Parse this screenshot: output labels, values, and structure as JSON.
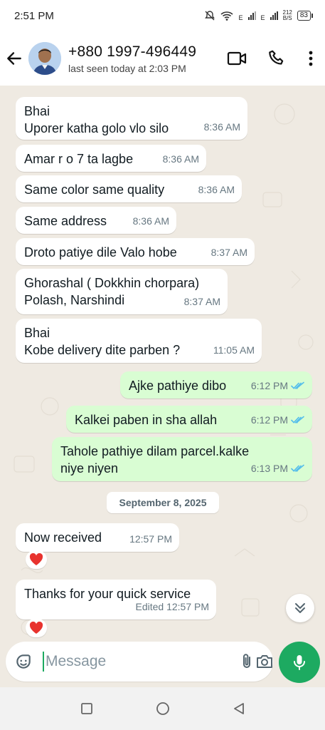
{
  "status_bar": {
    "time": "2:51 PM",
    "net_rate_top": "212",
    "net_rate_bottom": "B/S",
    "battery": "83",
    "sig_label_1": "E",
    "sig_label_2": "E"
  },
  "header": {
    "contact_name": "+880 1997-496449",
    "contact_status": "last seen today at 2:03 PM",
    "icons": [
      "back-arrow-icon",
      "video-call-icon",
      "phone-icon",
      "more-options-icon"
    ]
  },
  "messages": [
    {
      "dir": "in",
      "lines": [
        "Bhai",
        "Uporer katha golo vlo silo"
      ],
      "time": "8:36 AM"
    },
    {
      "dir": "in",
      "lines": [
        "Amar r o 7 ta lagbe"
      ],
      "time": "8:36 AM"
    },
    {
      "dir": "in",
      "lines": [
        "Same color same quality"
      ],
      "time": "8:36 AM"
    },
    {
      "dir": "in",
      "lines": [
        "Same address"
      ],
      "time": "8:36 AM"
    },
    {
      "dir": "in",
      "lines": [
        "Droto patiye dile Valo hobe"
      ],
      "time": "8:37 AM"
    },
    {
      "dir": "in",
      "lines": [
        "Ghorashal ( Dokkhin chorpara)",
        "Polash, Narshindi"
      ],
      "time": "8:37 AM"
    },
    {
      "dir": "in",
      "lines": [
        "Bhai",
        "Kobe delivery dite parben ?"
      ],
      "time": "11:05 AM"
    },
    {
      "dir": "out",
      "lines": [
        "Ajke pathiye dibo"
      ],
      "time": "6:12 PM",
      "read": true
    },
    {
      "dir": "out",
      "lines": [
        "Kalkei paben in sha allah"
      ],
      "time": "6:12 PM",
      "read": true
    },
    {
      "dir": "out",
      "lines": [
        "Tahole pathiye dilam parcel.kalke",
        "niye niyen"
      ],
      "time": "6:13 PM",
      "read": true
    }
  ],
  "date_separator": "September 8, 2025",
  "messages_after": [
    {
      "dir": "in",
      "lines": [
        "Now received"
      ],
      "time": "12:57 PM",
      "reaction": "heart"
    },
    {
      "dir": "in",
      "lines": [
        "Thanks for your quick service"
      ],
      "time": "Edited 12:57 PM",
      "reaction": "heart"
    }
  ],
  "composer": {
    "placeholder": "Message",
    "icons": [
      "sticker-icon",
      "attach-icon",
      "camera-icon",
      "mic-icon"
    ]
  },
  "colors": {
    "accent": "#1daa61",
    "outgoing_bubble": "#d9fdd3",
    "incoming_bubble": "#ffffff",
    "chat_bg": "#efeae2",
    "read_ticks": "#53bdeb",
    "reaction_heart": "#e8332e"
  }
}
